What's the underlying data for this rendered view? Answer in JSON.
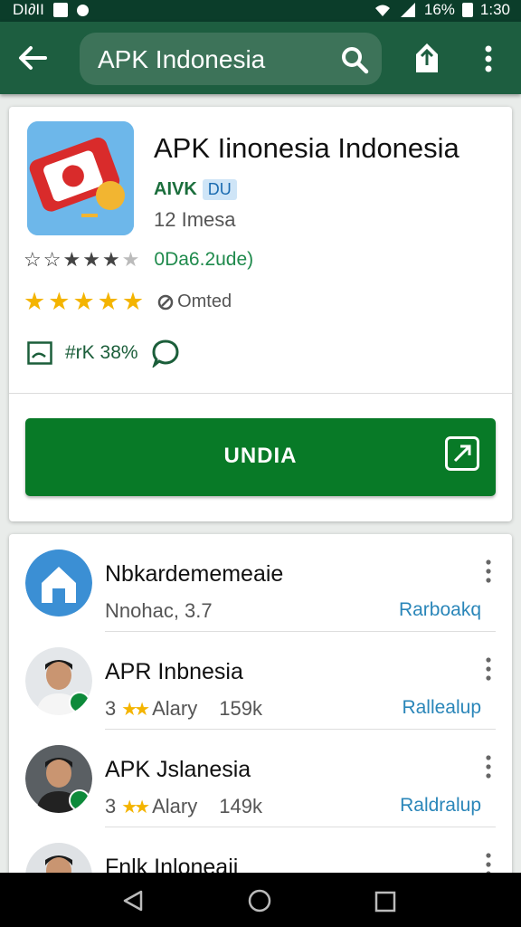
{
  "status_bar": {
    "carrier": "DI∂II",
    "battery": "16%",
    "time": "1:30"
  },
  "toolbar": {
    "search_query": "APK Indonesia",
    "icons": [
      "back-arrow-icon",
      "search-icon",
      "share-icon",
      "more-vert-icon"
    ]
  },
  "app": {
    "title": "APK Iinonesia Indonesia",
    "developer": "AIVK",
    "developer_badge": "DU",
    "subtitle": "12 Imesa",
    "rating_text_1": "0Da6.2ude)",
    "rating_label_2": "Omted",
    "meta_text": "#rK 38%",
    "install_label": "UNDIA"
  },
  "list": [
    {
      "title": "Nbkardememeaie",
      "subtitle": "Nnohac, 3.7",
      "action": "Rarboakq"
    },
    {
      "title": "APR Inbnesia",
      "rating": "3",
      "subtitle": "Alary",
      "size": "159k",
      "action": "Rallealup"
    },
    {
      "title": "APK Jslanesia",
      "rating": "3",
      "subtitle": "Alary",
      "size": "149k",
      "action": "Raldralup"
    },
    {
      "title": "Fnlk Inloneaii"
    }
  ],
  "colors": {
    "toolbar": "#1d5e40",
    "status_bar": "#0b3d2a",
    "install_button": "#087a27",
    "star": "#f4b400",
    "link": "#2a86b9"
  }
}
